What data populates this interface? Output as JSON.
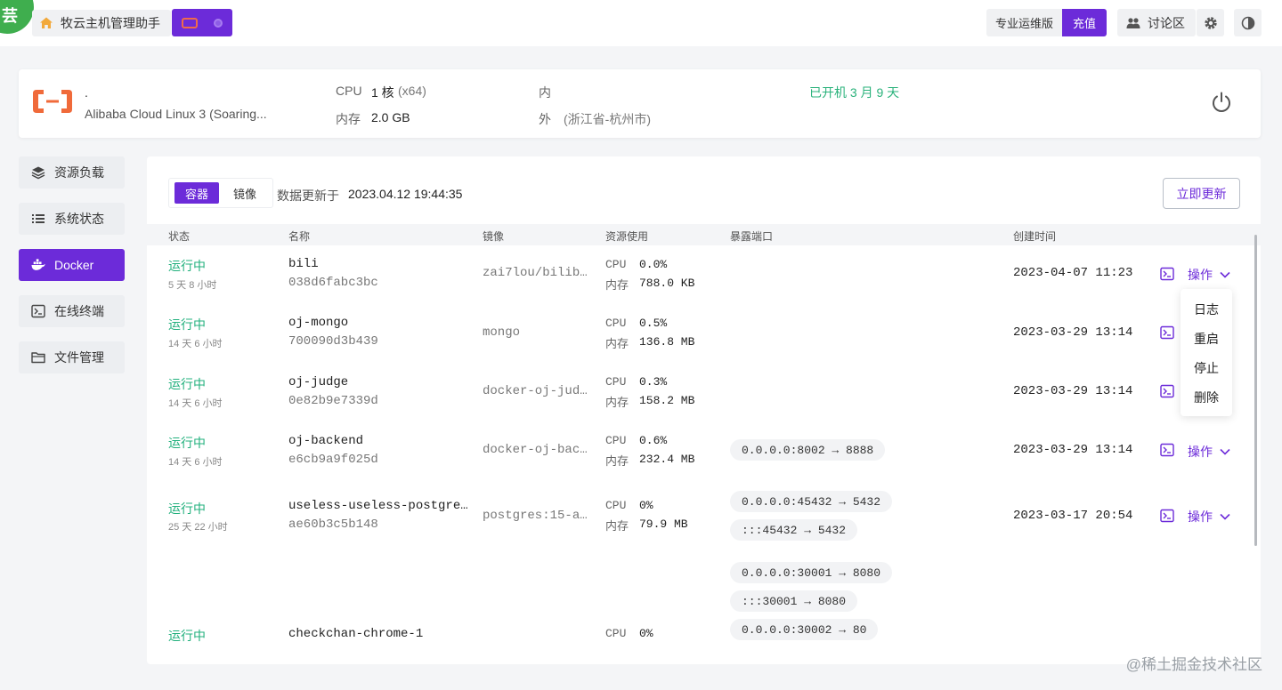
{
  "topbar": {
    "corner_glyph": "芸",
    "app_title": "牧云主机管理助手",
    "plan_label": "专业运维版",
    "recharge_label": "充值",
    "forum_label": "讨论区"
  },
  "server": {
    "name": ".",
    "os": "Alibaba Cloud Linux 3 (Soaring...",
    "cpu_label": "CPU",
    "cpu_value": "1 核",
    "cpu_arch": "(x64)",
    "mem_label": "内存",
    "mem_value": "2.0 GB",
    "inner_label": "内",
    "outer_label": "外",
    "location": "(浙江省-杭州市)",
    "uptime": "已开机 3 月 9 天"
  },
  "sidebar": {
    "items": [
      {
        "label": "资源负载",
        "icon": "layers-icon"
      },
      {
        "label": "系统状态",
        "icon": "list-icon"
      },
      {
        "label": "Docker",
        "icon": "docker-icon",
        "active": true
      },
      {
        "label": "在线终端",
        "icon": "terminal-icon"
      },
      {
        "label": "文件管理",
        "icon": "folder-icon"
      }
    ]
  },
  "toolbar": {
    "tab_containers": "容器",
    "tab_images": "镜像",
    "updated_label": "数据更新于",
    "updated_time": "2023.04.12 19:44:35",
    "refresh_label": "立即更新"
  },
  "table": {
    "headers": {
      "status": "状态",
      "name": "名称",
      "image": "镜像",
      "resources": "资源使用",
      "ports": "暴露端口",
      "created": "创建时间"
    },
    "rows": [
      {
        "status": "运行中",
        "duration": "5 天 8 小时",
        "name": "bili",
        "id": "038d6fabc3bc",
        "image": "zai7lou/bilib…",
        "cpu_label": "CPU",
        "cpu": "0.0%",
        "mem_label": "内存",
        "mem": "788.0 KB",
        "ports": [],
        "created": "2023-04-07 11:23",
        "action": "操作"
      },
      {
        "status": "运行中",
        "duration": "14 天 6 小时",
        "name": "oj-mongo",
        "id": "700090d3b439",
        "image": "mongo",
        "cpu_label": "CPU",
        "cpu": "0.5%",
        "mem_label": "内存",
        "mem": "136.8 MB",
        "ports": [],
        "created": "2023-03-29 13:14",
        "action": "操作"
      },
      {
        "status": "运行中",
        "duration": "14 天 6 小时",
        "name": "oj-judge",
        "id": "0e82b9e7339d",
        "image": "docker-oj-jud…",
        "cpu_label": "CPU",
        "cpu": "0.3%",
        "mem_label": "内存",
        "mem": "158.2 MB",
        "ports": [],
        "created": "2023-03-29 13:14",
        "action": "操作"
      },
      {
        "status": "运行中",
        "duration": "14 天 6 小时",
        "name": "oj-backend",
        "id": "e6cb9a9f025d",
        "image": "docker-oj-bac…",
        "cpu_label": "CPU",
        "cpu": "0.6%",
        "mem_label": "内存",
        "mem": "232.4 MB",
        "ports": [
          "0.0.0.0:8002 → 8888"
        ],
        "created": "2023-03-29 13:14",
        "action": "操作"
      },
      {
        "status": "运行中",
        "duration": "25 天 22 小时",
        "name": "useless-useless-postgre…",
        "id": "ae60b3c5b148",
        "image": "postgres:15-a…",
        "cpu_label": "CPU",
        "cpu": "0%",
        "mem_label": "内存",
        "mem": "79.9 MB",
        "ports": [
          "0.0.0.0:45432 → 5432",
          ":::45432 → 5432"
        ],
        "created": "2023-03-17 20:54",
        "action": "操作"
      },
      {
        "status": "运行中",
        "name": "checkchan-chrome-1",
        "cpu_label": "CPU",
        "cpu": "0%",
        "ports": [
          "0.0.0.0:30001 → 8080",
          ":::30001 → 8080",
          "0.0.0.0:30002 → 80"
        ]
      }
    ]
  },
  "dropdown": {
    "items": [
      "日志",
      "重启",
      "停止",
      "删除"
    ]
  },
  "watermark": "@稀土掘金技术社区",
  "colors": {
    "accent": "#6c2bd9",
    "running": "#22b07d",
    "uptime": "#2ab27b",
    "brand_orange": "#f06a4a"
  }
}
